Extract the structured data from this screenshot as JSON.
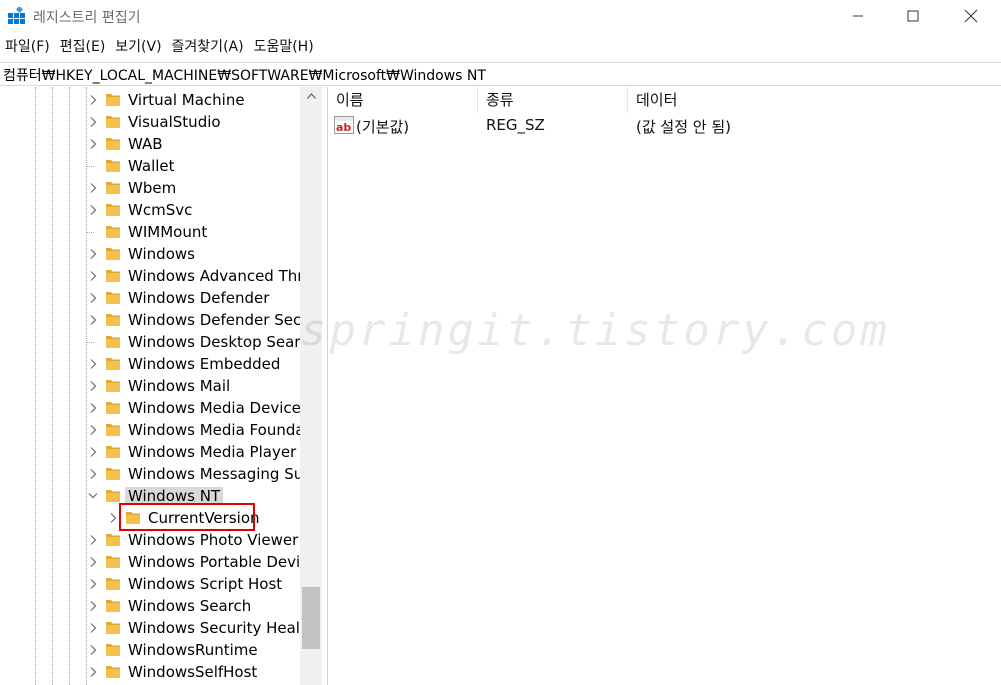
{
  "window": {
    "title": "레지스트리 편집기",
    "icon": "registry-editor-icon"
  },
  "menu": [
    {
      "label": "파일(F)"
    },
    {
      "label": "편집(E)"
    },
    {
      "label": "보기(V)"
    },
    {
      "label": "즐겨찾기(A)"
    },
    {
      "label": "도움말(H)"
    }
  ],
  "address": {
    "path": "컴퓨터₩HKEY_LOCAL_MACHINE₩SOFTWARE₩Microsoft₩Windows NT"
  },
  "tree": {
    "items": [
      {
        "label": "Virtual Machine",
        "expandable": true
      },
      {
        "label": "VisualStudio",
        "expandable": true
      },
      {
        "label": "WAB",
        "expandable": true
      },
      {
        "label": "Wallet",
        "expandable": false
      },
      {
        "label": "Wbem",
        "expandable": true
      },
      {
        "label": "WcmSvc",
        "expandable": true
      },
      {
        "label": "WIMMount",
        "expandable": false
      },
      {
        "label": "Windows",
        "expandable": true
      },
      {
        "label": "Windows Advanced Threat Protection",
        "expandable": true
      },
      {
        "label": "Windows Defender",
        "expandable": true
      },
      {
        "label": "Windows Defender Security Center",
        "expandable": true
      },
      {
        "label": "Windows Desktop Search",
        "expandable": false
      },
      {
        "label": "Windows Embedded",
        "expandable": true
      },
      {
        "label": "Windows Mail",
        "expandable": true
      },
      {
        "label": "Windows Media Device Manager",
        "expandable": true
      },
      {
        "label": "Windows Media Foundation",
        "expandable": true
      },
      {
        "label": "Windows Media Player NSS",
        "expandable": true
      },
      {
        "label": "Windows Messaging Subsystem",
        "expandable": true
      },
      {
        "label": "Windows NT",
        "expandable": true,
        "expanded": true,
        "selected": true
      },
      {
        "label": "CurrentVersion",
        "expandable": true,
        "child": true,
        "highlighted": true
      },
      {
        "label": "Windows Photo Viewer",
        "expandable": true
      },
      {
        "label": "Windows Portable Devices",
        "expandable": true
      },
      {
        "label": "Windows Script Host",
        "expandable": true
      },
      {
        "label": "Windows Search",
        "expandable": true
      },
      {
        "label": "Windows Security Health",
        "expandable": true
      },
      {
        "label": "WindowsRuntime",
        "expandable": true
      },
      {
        "label": "WindowsSelfHost",
        "expandable": true
      }
    ]
  },
  "list": {
    "columns": [
      {
        "label": "이름"
      },
      {
        "label": "종류"
      },
      {
        "label": "데이터"
      }
    ],
    "rows": [
      {
        "name": "(기본값)",
        "type": "REG_SZ",
        "data": "(값 설정 안 됨)",
        "icon": "string-value-icon"
      }
    ]
  },
  "watermark": "springit.tistory.com",
  "colors": {
    "folder": "#f2c14e",
    "highlight": "#e00000",
    "selection": "#d9d9d9",
    "icon_blue": "#0078d7"
  }
}
